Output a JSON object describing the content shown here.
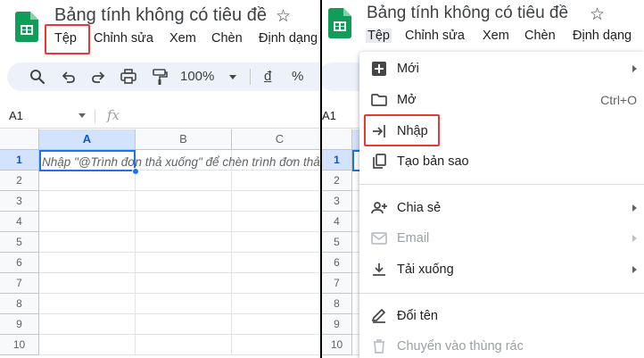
{
  "app": {
    "doc_title": "Bảng tính không có tiêu đề",
    "brand_color": "#0f9d58"
  },
  "menubar": [
    "Tệp",
    "Chỉnh sửa",
    "Xem",
    "Chèn",
    "Định dạng"
  ],
  "toolbar": {
    "zoom": "100%",
    "currency": "đ",
    "percent": "%"
  },
  "formula_bar": {
    "name_box": "A1",
    "fx_label": "fx"
  },
  "grid": {
    "columns": [
      "A",
      "B",
      "C"
    ],
    "rows": [
      "1",
      "2",
      "3",
      "4",
      "5",
      "6",
      "7",
      "8",
      "9",
      "10"
    ],
    "active_cell": "A1",
    "cell_a1_hint": "Nhập \"@Trình đơn thả xuống\" để chèn trình đơn thả xuống"
  },
  "file_menu": {
    "items": [
      {
        "label": "Mới",
        "icon": "new-sheet-icon",
        "submenu": true,
        "shortcut": ""
      },
      {
        "label": "Mở",
        "icon": "folder-icon",
        "submenu": false,
        "shortcut": "Ctrl+O"
      },
      {
        "label": "Nhập",
        "icon": "import-icon",
        "submenu": false,
        "shortcut": ""
      },
      {
        "label": "Tạo bản sao",
        "icon": "copy-icon",
        "submenu": false,
        "shortcut": ""
      },
      {
        "label": "Chia sẻ",
        "icon": "share-person-icon",
        "submenu": true,
        "shortcut": ""
      },
      {
        "label": "Email",
        "icon": "email-icon",
        "submenu": true,
        "shortcut": "",
        "disabled": true
      },
      {
        "label": "Tải xuống",
        "icon": "download-icon",
        "submenu": true,
        "shortcut": ""
      },
      {
        "label": "Đổi tên",
        "icon": "rename-icon",
        "submenu": false,
        "shortcut": ""
      },
      {
        "label": "Chuyển vào thùng rác",
        "icon": "trash-icon",
        "submenu": false,
        "shortcut": "",
        "disabled": true
      }
    ]
  },
  "highlight_color": "#e53935",
  "selection_color": "#1a73e8"
}
